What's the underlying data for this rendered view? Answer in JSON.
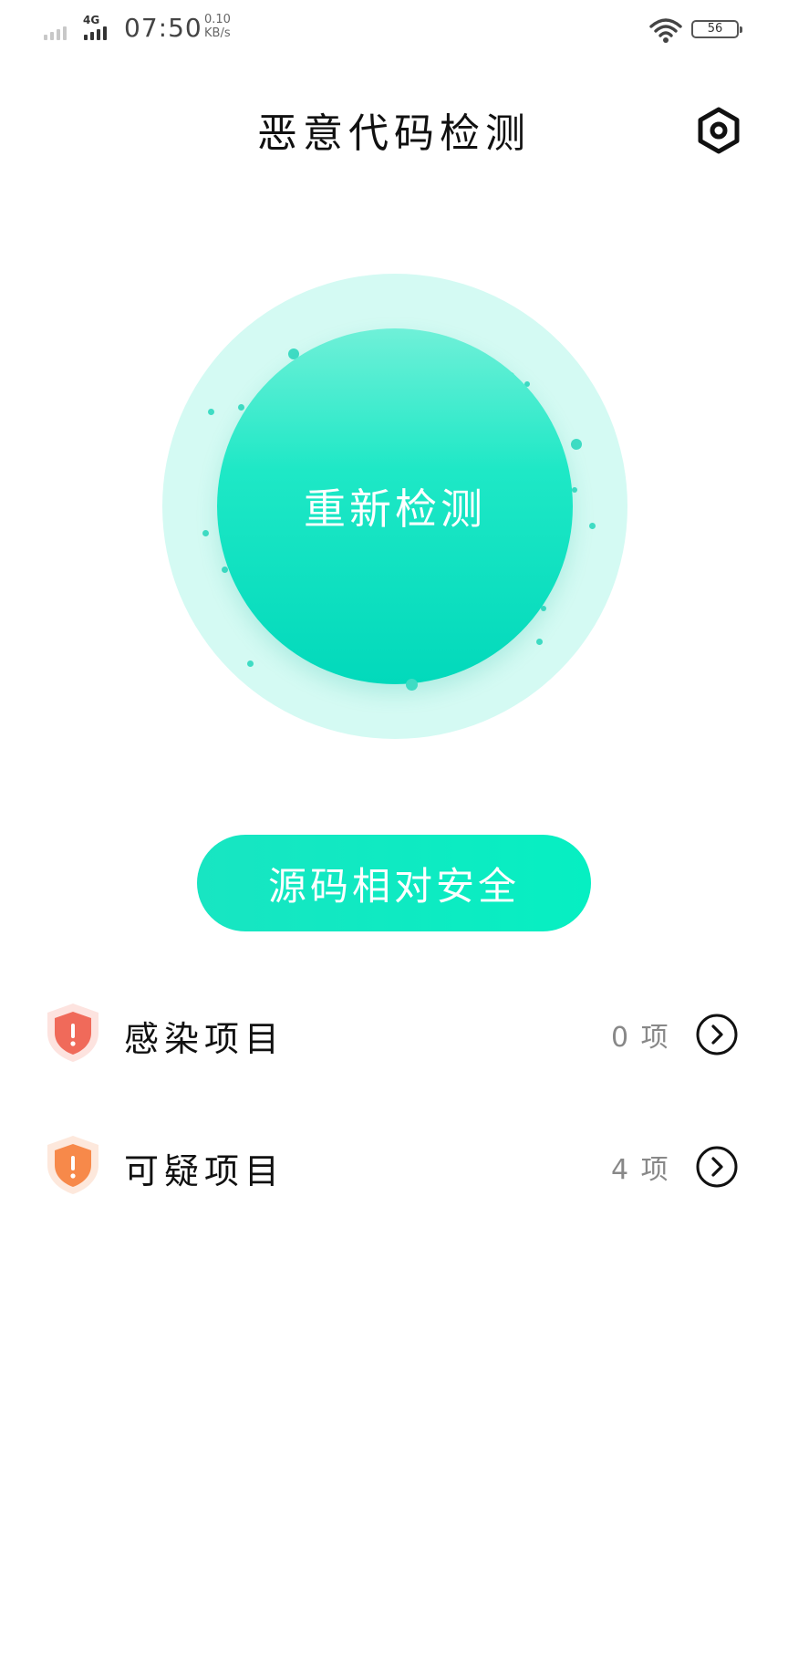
{
  "status_bar": {
    "network_type": "4G",
    "time": "07:50",
    "speed_value": "0.10",
    "speed_unit": "KB/s",
    "battery": "56"
  },
  "header": {
    "title": "恶意代码检测",
    "settings_icon": "settings-hexagon-icon"
  },
  "scan": {
    "button_label": "重新检测"
  },
  "status": {
    "label": "源码相对安全"
  },
  "results": [
    {
      "label": "感染项目",
      "count": "0 项",
      "icon": "shield-alert-icon",
      "color": "#f06a5a"
    },
    {
      "label": "可疑项目",
      "count": "4 项",
      "icon": "shield-alert-icon",
      "color": "#f7894a"
    }
  ],
  "colors": {
    "accent": "#0ee6c0",
    "accent_light": "#d4faf3"
  }
}
